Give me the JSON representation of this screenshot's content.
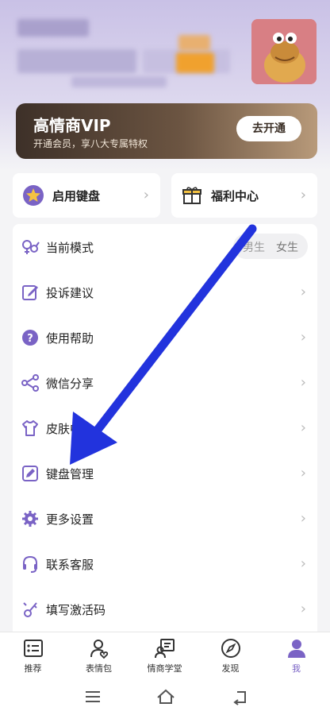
{
  "vip": {
    "title": "高情商VIP",
    "subtitle": "开通会员，享八大专属特权",
    "button": "去开通"
  },
  "quick_cards": [
    {
      "label": "启用键盘",
      "icon": "star-badge-icon"
    },
    {
      "label": "福利中心",
      "icon": "gift-icon"
    }
  ],
  "menu": {
    "mode": {
      "label": "当前模式",
      "options": [
        "男生",
        "女生"
      ],
      "selected": "男生"
    },
    "items": [
      {
        "label": "投诉建议",
        "icon": "edit-icon"
      },
      {
        "label": "使用帮助",
        "icon": "help-icon"
      },
      {
        "label": "微信分享",
        "icon": "share-icon"
      },
      {
        "label": "皮肤中心",
        "icon": "shirt-icon"
      },
      {
        "label": "键盘管理",
        "icon": "pencil-icon"
      },
      {
        "label": "更多设置",
        "icon": "gear-icon"
      },
      {
        "label": "联系客服",
        "icon": "headset-icon"
      },
      {
        "label": "填写激活码",
        "icon": "key-icon"
      }
    ]
  },
  "tabs": [
    {
      "label": "推荐",
      "icon": "list-icon"
    },
    {
      "label": "表情包",
      "icon": "sticker-icon"
    },
    {
      "label": "情商学堂",
      "icon": "classroom-icon"
    },
    {
      "label": "发现",
      "icon": "compass-icon"
    },
    {
      "label": "我",
      "icon": "profile-icon",
      "active": true
    }
  ],
  "colors": {
    "accent": "#7a63c5",
    "annotation_arrow": "#2233dd"
  }
}
